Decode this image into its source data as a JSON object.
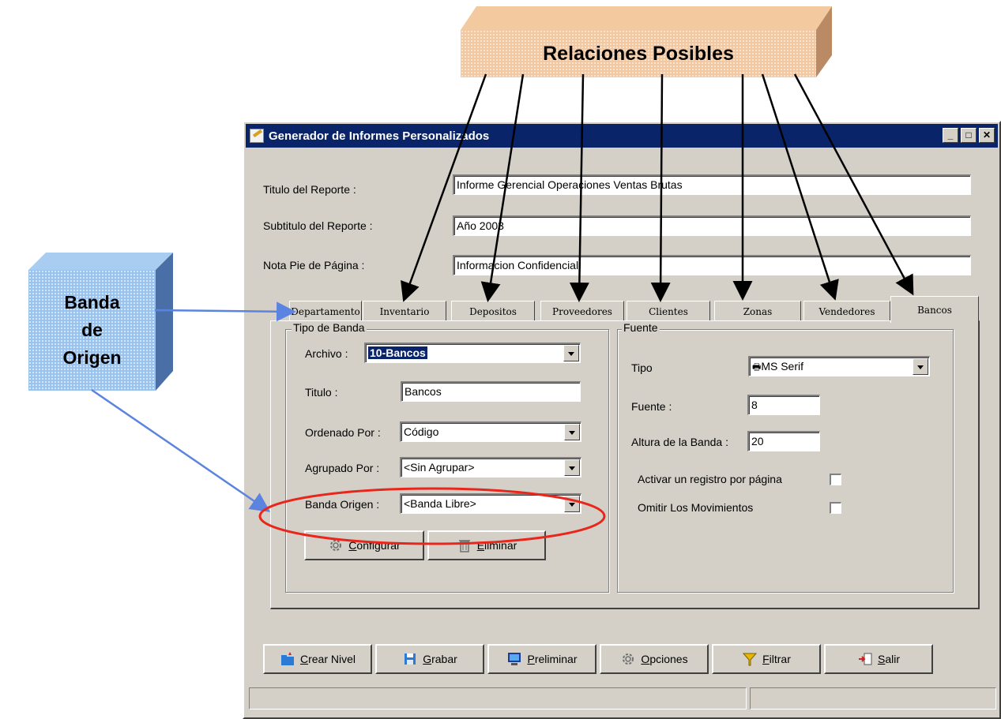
{
  "annotations": {
    "relaciones_label": "Relaciones Posibles",
    "banda_line1": "Banda",
    "banda_line2": "de",
    "banda_line3": "Origen"
  },
  "window": {
    "title": "Generador de Informes Personalizados",
    "fields": {
      "titulo_label": "Titulo del Reporte :",
      "titulo_value": "Informe Gerencial  Operaciones Ventas Brutas",
      "subtitulo_label": "Subtitulo del Reporte :",
      "subtitulo_value": "Año 2003",
      "nota_label": "Nota Pie de Página :",
      "nota_value": "Informacion Confidencial"
    },
    "tabs": [
      "Departamento",
      "Inventario",
      "Depositos",
      "Proveedores",
      "Clientes",
      "Zonas",
      "Vendedores",
      "Bancos"
    ],
    "active_tab": "Bancos",
    "tipo_banda": {
      "title": "Tipo de Banda",
      "archivo_label": "Archivo :",
      "archivo_value": "10-Bancos",
      "titulo_label": "Titulo :",
      "titulo_value": "Bancos",
      "ordenado_label": "Ordenado Por :",
      "ordenado_value": "Código",
      "agrupado_label": "Agrupado Por :",
      "agrupado_value": "<Sin Agrupar>",
      "banda_label": "Banda Origen :",
      "banda_value": "<Banda Libre>",
      "configurar": "Configurar",
      "eliminar": "Eliminar"
    },
    "fuente": {
      "title": "Fuente",
      "tipo_label": "Tipo",
      "tipo_value": "MS Serif",
      "fuente_label": "Fuente :",
      "fuente_value": "8",
      "altura_label": "Altura de la Banda :",
      "altura_value": "20",
      "activar_label": "Activar un registro por página",
      "omitir_label": "Omitir Los Movimientos"
    },
    "bottom_buttons": [
      "Crear Nivel",
      "Grabar",
      "Preliminar",
      "Opciones",
      "Filtrar",
      "Salir"
    ]
  },
  "colors": {
    "titlebar": "#0a246a",
    "window_bg": "#d4d0c8",
    "highlight_ellipse": "#e8261c",
    "arrow_blue": "#5b84e0",
    "rel_box": "#f2c8a2",
    "banda_box": "#99c3ef"
  }
}
